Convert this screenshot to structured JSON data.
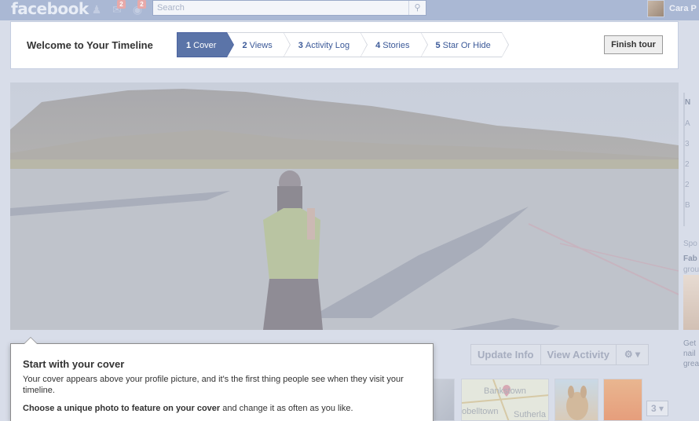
{
  "header": {
    "logo": "facebook",
    "search_placeholder": "Search",
    "friend_requests_count": "",
    "messages_count": "2",
    "notifications_count": "2",
    "user_name": "Cara P"
  },
  "tour": {
    "title": "Welcome to Your Timeline",
    "steps": [
      {
        "num": "1",
        "label": "Cover"
      },
      {
        "num": "2",
        "label": "Views"
      },
      {
        "num": "3",
        "label": "Activity Log"
      },
      {
        "num": "4",
        "label": "Stories"
      },
      {
        "num": "5",
        "label": "Star Or Hide"
      }
    ],
    "finish_label": "Finish tour"
  },
  "actions": {
    "update_info": "Update Info",
    "view_activity": "View Activity",
    "gear": "⚙ ▾"
  },
  "apps": {
    "map_label_1": "Bankstown",
    "map_label_2": "obelltown",
    "map_label_3": "Sutherla",
    "card_label": "",
    "count_label": "3 ▾"
  },
  "right_col": {
    "items": [
      "N",
      "A",
      "3",
      "2",
      "2",
      "B"
    ],
    "sponsored": "Spo",
    "ad_title": "Fab",
    "ad_sub": "grou",
    "ad2_line1": "Get",
    "ad2_line2": "nail",
    "ad2_line3": "grea"
  },
  "popup": {
    "title": "Start with your cover",
    "desc": "Your cover appears above your profile picture, and it's the first thing people see when they visit your timeline.",
    "line2_bold": "Choose a unique photo to feature on your cover",
    "line2_rest": " and change it as often as you like."
  },
  "colors": {
    "facebook_blue": "#3b5998",
    "active_step": "#5b74a8",
    "overlay": "#d8dde9"
  }
}
